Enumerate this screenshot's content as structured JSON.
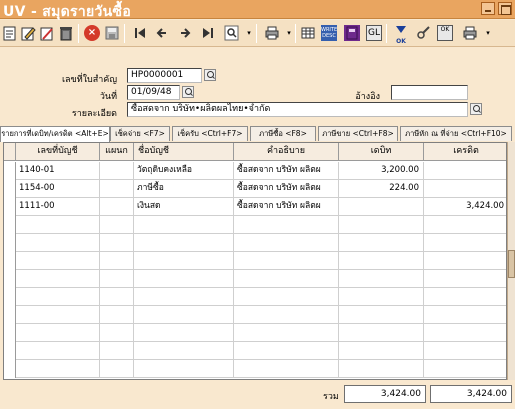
{
  "window": {
    "title": "UV - สมุดรายวันซื้อ"
  },
  "toolbar": {
    "icons": [
      "new-doc-icon",
      "edit-icon",
      "edit-notes-icon",
      "delete-icon",
      "cancel-icon",
      "save-icon",
      "first-icon",
      "prev-icon",
      "next-icon",
      "last-icon",
      "find-icon",
      "print-icon",
      "write-desc-icon",
      "book-icon",
      "gl-icon",
      "ok-icon",
      "tools-icon",
      "ok2-icon"
    ],
    "write_desc_label": "WRITE DESC",
    "gl_label": "GL",
    "ok_label": "OK"
  },
  "form": {
    "voucher_label": "เลขที่ใบสำคัญ",
    "voucher_value": "HP0000001",
    "date_label": "วันที่",
    "date_value": "01/09/48",
    "ref_label": "อ้างอิง",
    "ref_value": "",
    "detail_label": "รายละเอียด",
    "detail_value": "ซื้อสดจาก      บริษัท•ผลิตผลไทย•จำกัด"
  },
  "tabs": [
    {
      "label": "รายการที่เดบิท/เครดิต <Alt+E>",
      "active": true
    },
    {
      "label": "เช็คจ่าย <F7>",
      "active": false
    },
    {
      "label": "เช็ครับ <Ctrl+F7>",
      "active": false
    },
    {
      "label": "ภาษีซื้อ <F8>",
      "active": false
    },
    {
      "label": "ภาษีขาย <Ctrl+F8>",
      "active": false
    },
    {
      "label": "ภาษีหัก ณ ที่จ่าย <Ctrl+F10>",
      "active": false
    }
  ],
  "grid": {
    "columns": [
      "เลขที่บัญชี",
      "แผนก",
      "ชื่อบัญชี",
      "คำอธิบาย",
      "เดบิท",
      "เครดิต"
    ],
    "rows": [
      {
        "account": "1140-01",
        "dept": "",
        "name": "วัตถุดิบคงเหลือ",
        "desc": "ซื้อสดจาก    บริษัท ผลิตผ",
        "debit": "3,200.00",
        "credit": ""
      },
      {
        "account": "1154-00",
        "dept": "",
        "name": "ภาษีซื้อ",
        "desc": "ซื้อสดจาก    บริษัท ผลิตผ",
        "debit": "224.00",
        "credit": ""
      },
      {
        "account": "1111-00",
        "dept": "",
        "name": "เงินสด",
        "desc": "ซื้อสดจาก    บริษัท ผลิตผ",
        "debit": "",
        "credit": "3,424.00"
      }
    ]
  },
  "totals": {
    "label": "รวม",
    "debit": "3,424.00",
    "credit": "3,424.00"
  }
}
